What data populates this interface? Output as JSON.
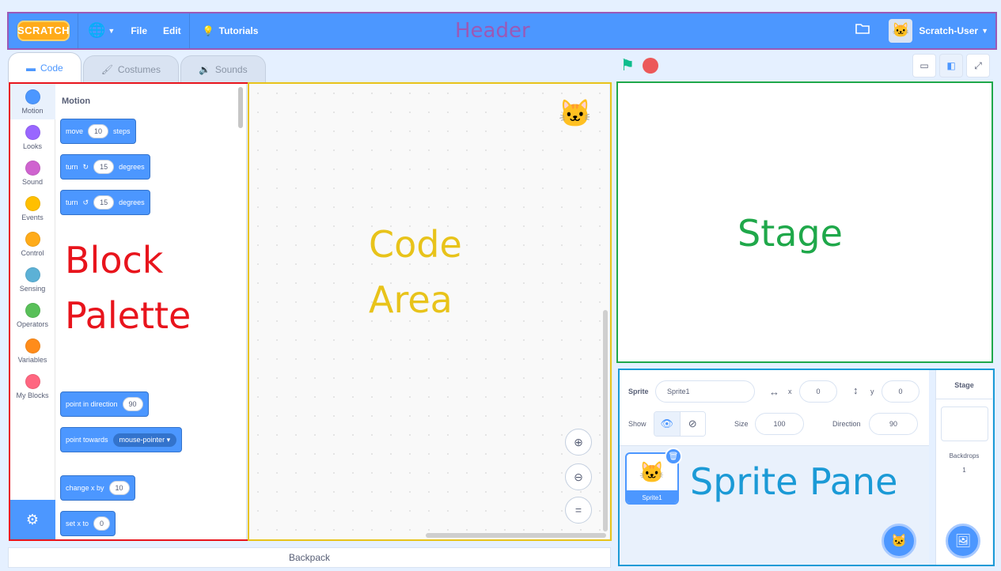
{
  "header": {
    "logo": "SCRATCH",
    "menu": [
      "File",
      "Edit"
    ],
    "tutorials": "Tutorials",
    "username": "Scratch-User"
  },
  "tabs": [
    {
      "label": "Code"
    },
    {
      "label": "Costumes"
    },
    {
      "label": "Sounds"
    }
  ],
  "categories": [
    {
      "label": "Motion",
      "color": "#4c97ff"
    },
    {
      "label": "Looks",
      "color": "#9966ff"
    },
    {
      "label": "Sound",
      "color": "#cf63cf"
    },
    {
      "label": "Events",
      "color": "#ffbf00"
    },
    {
      "label": "Control",
      "color": "#ffab19"
    },
    {
      "label": "Sensing",
      "color": "#5cb1d6"
    },
    {
      "label": "Operators",
      "color": "#59c059"
    },
    {
      "label": "Variables",
      "color": "#ff8c1a"
    },
    {
      "label": "My Blocks",
      "color": "#ff6680"
    }
  ],
  "palette": {
    "section_title": "Motion",
    "blocks": {
      "move": {
        "pre": "move",
        "value": "10",
        "post": "steps"
      },
      "turn_right": {
        "pre": "turn",
        "value": "15",
        "post": "degrees"
      },
      "turn_left": {
        "pre": "turn",
        "value": "15",
        "post": "degrees"
      },
      "point_direction": {
        "pre": "point in direction",
        "value": "90"
      },
      "point_towards": {
        "pre": "point towards",
        "value": "mouse-pointer"
      },
      "change_x": {
        "pre": "change x by",
        "value": "10"
      },
      "set_x": {
        "pre": "set x to",
        "value": "0"
      }
    }
  },
  "backpack": "Backpack",
  "sprite_info": {
    "sprite_label": "Sprite",
    "sprite_name": "Sprite1",
    "x_label": "x",
    "x_value": "0",
    "y_label": "y",
    "y_value": "0",
    "show_label": "Show",
    "size_label": "Size",
    "size_value": "100",
    "direction_label": "Direction",
    "direction_value": "90"
  },
  "sprites": [
    {
      "name": "Sprite1"
    }
  ],
  "stage_selector": {
    "title": "Stage",
    "backdrops_label": "Backdrops",
    "backdrops_count": "1"
  },
  "annotations": {
    "header": {
      "label": "Header",
      "color": "#9b59b6"
    },
    "palette": {
      "line1": "Block",
      "line2": "Palette",
      "color": "#e8141c"
    },
    "code": {
      "line1": "Code",
      "line2": "Area",
      "color": "#e8c31a"
    },
    "stage": {
      "label": "Stage",
      "color": "#1fa84a"
    },
    "sprite": {
      "label": "Sprite Pane",
      "color": "#1b9ad6"
    }
  }
}
